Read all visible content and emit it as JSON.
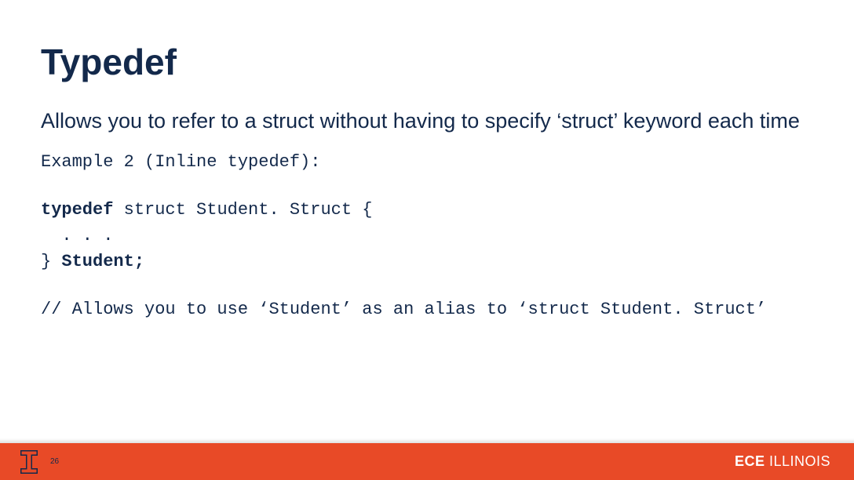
{
  "title": "Typedef",
  "description": "Allows you to refer to a struct without having to specify ‘struct’ keyword each time",
  "code": {
    "example_label": "Example 2 (Inline typedef):",
    "l1_kw": "typedef",
    "l1_rest": " struct Student. Struct {",
    "l2": "  . . .",
    "l3_brace": "} ",
    "l3_name": "Student;",
    "comment": "// Allows you to use ‘Student’ as an alias to ‘struct Student. Struct’"
  },
  "footer": {
    "page": "26",
    "ece_bold": "ECE",
    "ece_thin": " ILLINOIS"
  }
}
